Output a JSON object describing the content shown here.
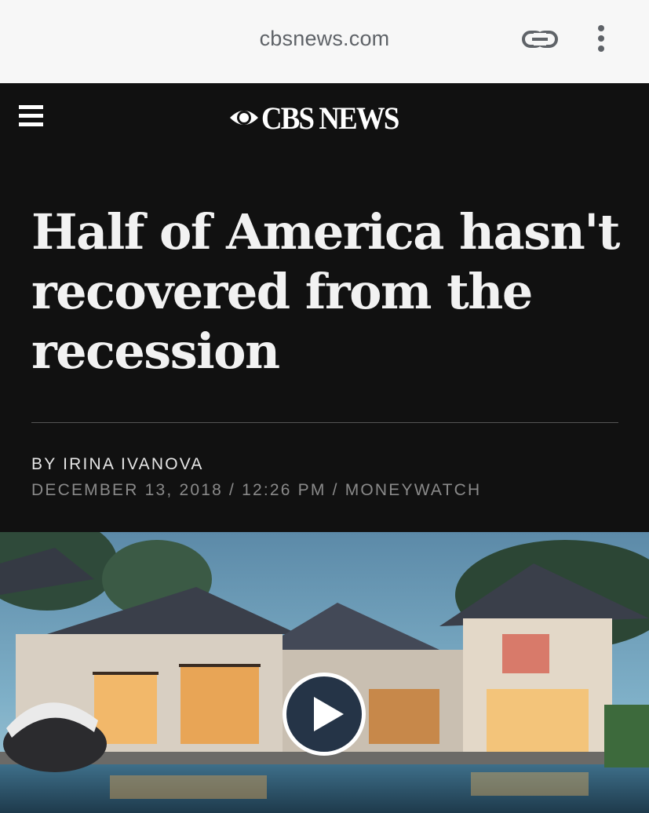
{
  "browser": {
    "url": "cbsnews.com",
    "link_icon": "link-icon",
    "menu_icon": "more-vert-icon"
  },
  "header": {
    "logo_text": "CBS NEWS",
    "menu_icon": "hamburger-menu-icon"
  },
  "article": {
    "headline": "Half of America hasn't recovered from the recession",
    "byline": "BY IRINA IVANOVA",
    "dateline": "DECEMBER 13, 2018 / 12:26 PM / MONEYWATCH"
  },
  "media": {
    "play_icon": "play-icon"
  },
  "colors": {
    "browser_bar": "#f7f7f7",
    "header_bg": "#111111",
    "text_primary": "#f2f2f2",
    "text_muted": "#8a8a8a",
    "play_button": "#253447"
  }
}
